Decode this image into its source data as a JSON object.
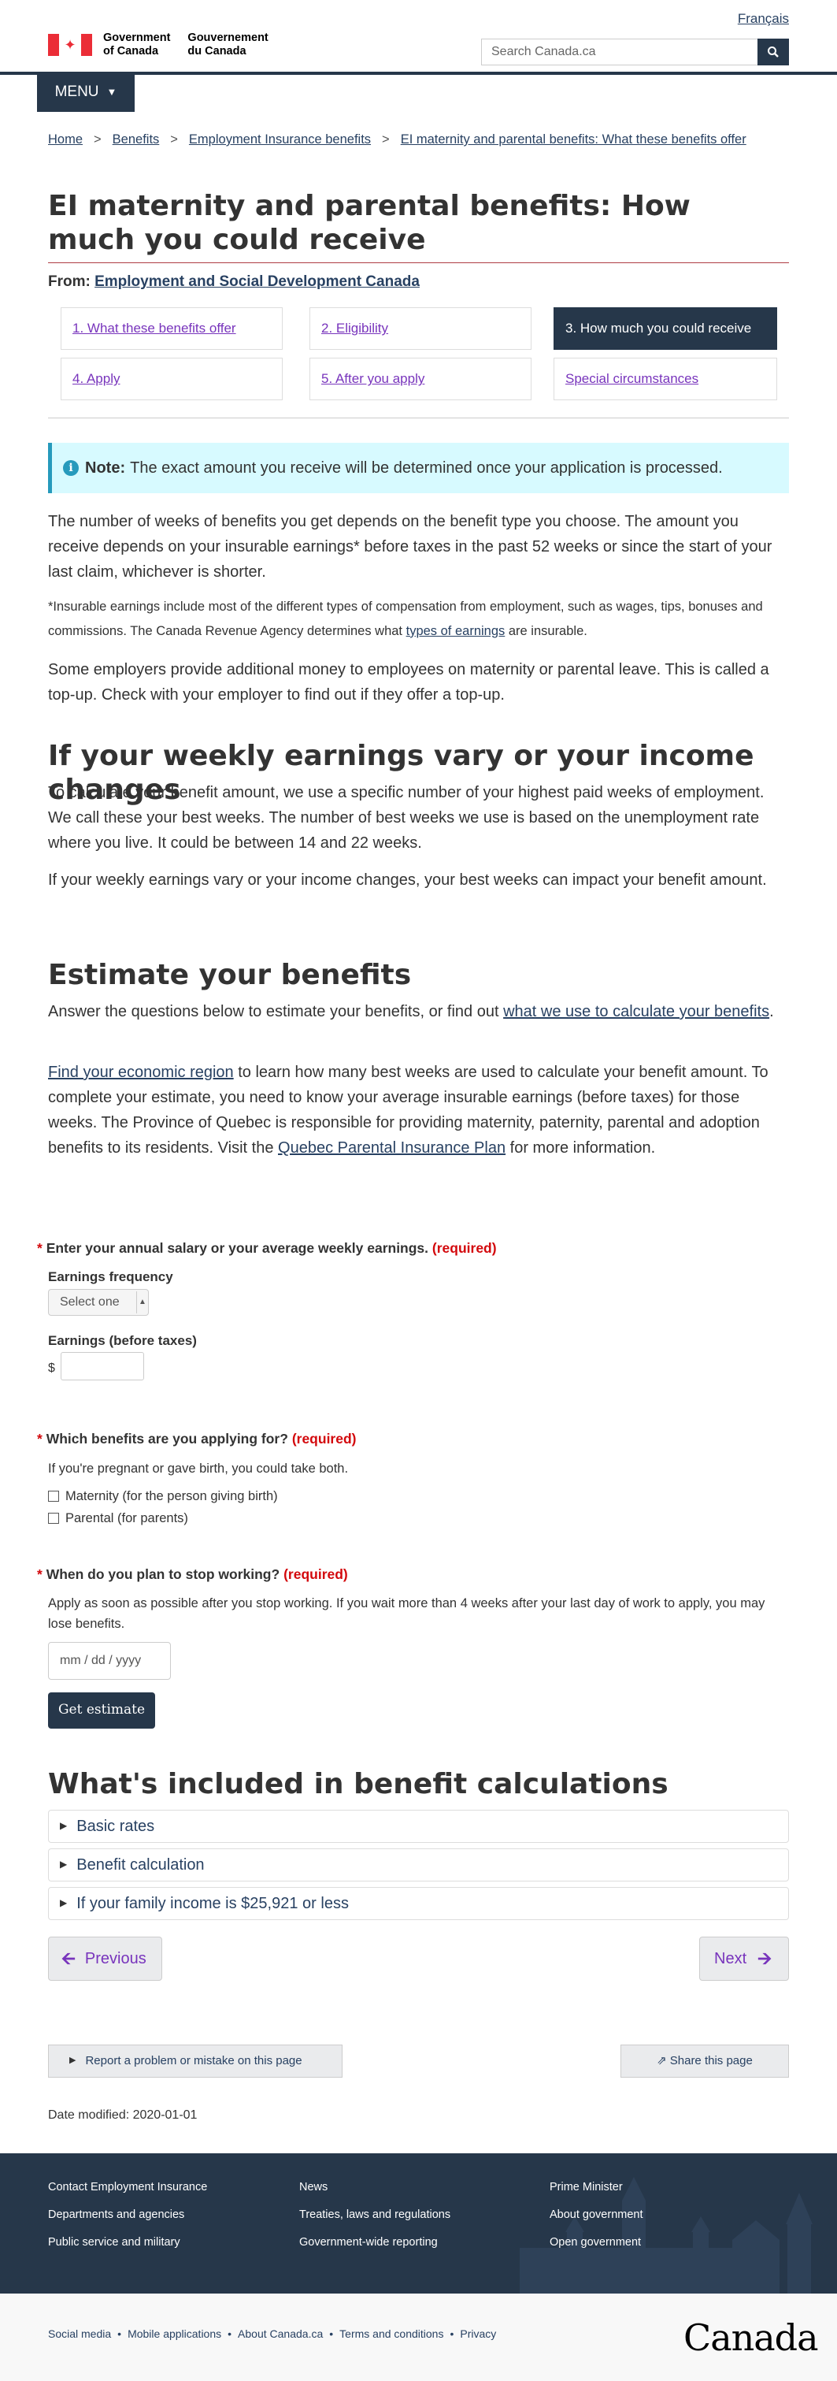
{
  "header": {
    "language_link": "Français",
    "gov_en": [
      "Government",
      "of Canada"
    ],
    "gov_fr": [
      "Gouvernement",
      "du Canada"
    ],
    "search_placeholder": "Search Canada.ca",
    "menu_label": "MENU"
  },
  "breadcrumb": [
    "Home",
    "Benefits",
    "Employment Insurance benefits",
    "EI maternity and parental benefits: What these benefits offer"
  ],
  "page_title": "EI maternity and parental benefits: How much you could receive",
  "from_label": "From:",
  "from_link": "Employment and Social Development Canada",
  "steps": [
    {
      "label": "1. What these benefits offer",
      "active": false
    },
    {
      "label": "2. Eligibility",
      "active": false
    },
    {
      "label": "3. How much you could receive",
      "active": true
    },
    {
      "label": "4. Apply",
      "active": false
    },
    {
      "label": "5. After you apply",
      "active": false
    },
    {
      "label": "Special circumstances",
      "active": false
    }
  ],
  "note": {
    "label": "Note:",
    "text": "The exact amount you receive will be determined once your application is processed."
  },
  "intro": {
    "p1": "The number of weeks of benefits you get depends on the benefit type you choose. The amount you receive depends on your insurable earnings* before taxes in the past 52 weeks or since the start of your last claim, whichever is shorter.",
    "p2_a": "*Insurable earnings include most of the different types of compensation from employment, such as wages, tips, bonuses and commissions. The Canada Revenue Agency determines what ",
    "p2_link": "types of earnings",
    "p2_b": " are insurable.",
    "p3": "Some employers provide additional money to employees on maternity or parental leave. This is called a top-up. Check with your employer to find out if they offer a top-up."
  },
  "vary": {
    "heading": "If your weekly earnings vary or your income changes",
    "p1": "To calculate your benefit amount, we use a specific number of your highest paid weeks of employment. We call these your best weeks. The number of best weeks we use is based on the unemployment rate where you live. It could be between 14 and 22 weeks.",
    "p2": "If your weekly earnings vary or your income changes, your best weeks can impact your benefit amount."
  },
  "estimate": {
    "heading": "Estimate your benefits",
    "p1_a": "Answer the questions below to estimate your benefits, or find out ",
    "p1_link": "what we use to calculate your benefits",
    "p1_b": ".",
    "p2_link1": "Find your economic region",
    "p2_a": " to learn how many best weeks are used to calculate your benefit amount. To complete your estimate, you need to know your average insurable earnings (before taxes) for those weeks. The Province of Quebec is responsible for providing maternity, paternity, parental and adoption benefits to its residents. Visit the ",
    "p2_link2": "Quebec Parental Insurance Plan",
    "p2_b": " for more information."
  },
  "form": {
    "required": "(required)",
    "q1": "Enter your annual salary or your average weekly earnings.",
    "freq_label": "Earnings frequency",
    "freq_value": "Select one",
    "earn_label": "Earnings (before taxes)",
    "currency": "$",
    "q2": "Which benefits are you applying for?",
    "q2_hint": "If you're pregnant or gave birth, you could take both.",
    "opt1": "Maternity (for the person giving birth)",
    "opt2": "Parental (for parents)",
    "q3": "When do you plan to stop working?",
    "q3_hint": "Apply as soon as possible after you stop working. If you wait more than 4 weeks after your last day of work to apply, you may lose benefits.",
    "date_placeholder": "mm / dd / yyyy",
    "submit": "Get estimate"
  },
  "included": {
    "heading": "What's included in benefit calculations",
    "items": [
      "Basic rates",
      "Benefit calculation",
      "If your family income is $25,921 or less"
    ]
  },
  "pager": {
    "previous": "Previous",
    "next": "Next"
  },
  "report": "Report a problem or mistake on this page",
  "share": "Share this page",
  "date_modified": "Date modified: 2020-01-01",
  "footer": {
    "col1": [
      "Contact Employment Insurance",
      "Departments and agencies",
      "Public service and military"
    ],
    "col2": [
      "News",
      "Treaties, laws and regulations",
      "Government-wide reporting"
    ],
    "col3": [
      "Prime Minister",
      "About government",
      "Open government"
    ],
    "bottom": [
      "Social media",
      "Mobile applications",
      "About Canada.ca",
      "Terms and conditions",
      "Privacy"
    ],
    "wordmark": "Canada"
  },
  "colors": {
    "brand_dark": "#26374a",
    "link": "#284162",
    "visited": "#7834bc",
    "flag_red": "#eb2d37",
    "note_bg": "#d7faff"
  }
}
